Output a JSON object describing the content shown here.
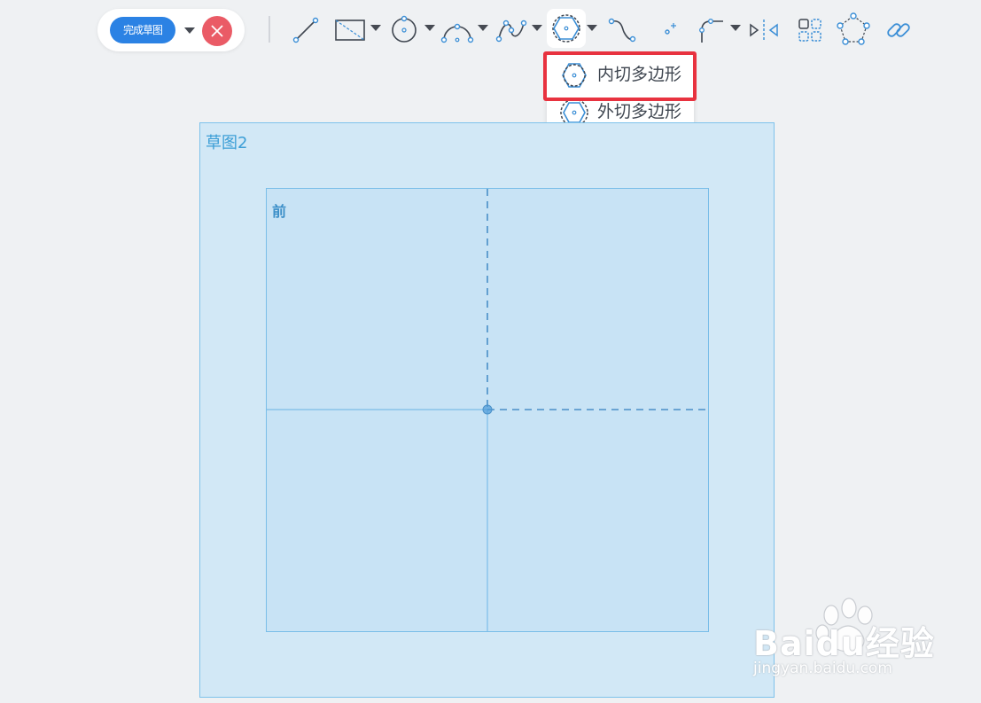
{
  "toolbar": {
    "finish_sketch_label": "完成草图",
    "tools": [
      {
        "name": "line-tool",
        "icon": "line-icon",
        "has_dropdown": false
      },
      {
        "name": "rectangle-tool",
        "icon": "rectangle-icon",
        "has_dropdown": true
      },
      {
        "name": "circle-tool",
        "icon": "circle-icon",
        "has_dropdown": true
      },
      {
        "name": "arc-tool",
        "icon": "arc-icon",
        "has_dropdown": true
      },
      {
        "name": "spline-tool",
        "icon": "spline-icon",
        "has_dropdown": true
      },
      {
        "name": "polygon-tool",
        "icon": "polygon-icon",
        "has_dropdown": true,
        "active": true
      },
      {
        "name": "curve-tool",
        "icon": "curve-icon",
        "has_dropdown": false
      },
      {
        "name": "point-tool",
        "icon": "point-icon",
        "has_dropdown": false
      },
      {
        "name": "fillet-tool",
        "icon": "fillet-icon",
        "has_dropdown": true
      },
      {
        "name": "mirror-tool",
        "icon": "mirror-icon",
        "has_dropdown": false
      },
      {
        "name": "pattern-tool",
        "icon": "pattern-icon",
        "has_dropdown": false
      },
      {
        "name": "polygon-pattern-tool",
        "icon": "circular-pattern-icon",
        "has_dropdown": false
      },
      {
        "name": "constraint-tool",
        "icon": "link-icon",
        "has_dropdown": false
      }
    ]
  },
  "polygon_menu": {
    "items": [
      {
        "label": "内切多边形",
        "highlighted": true
      },
      {
        "label": "外切多边形",
        "highlighted": false
      }
    ]
  },
  "canvas": {
    "sketch_name": "草图2",
    "plane_name": "前"
  },
  "watermark": {
    "brand": "Baidu经验",
    "url": "jingyan.baidu.com"
  },
  "colors": {
    "accent": "#2b82e4",
    "cancel": "#ea5b66",
    "highlight": "#e8323f",
    "sketch_fill": "#d2e8f6",
    "plane_fill": "#c8e3f5",
    "icon": "#3f4650"
  }
}
